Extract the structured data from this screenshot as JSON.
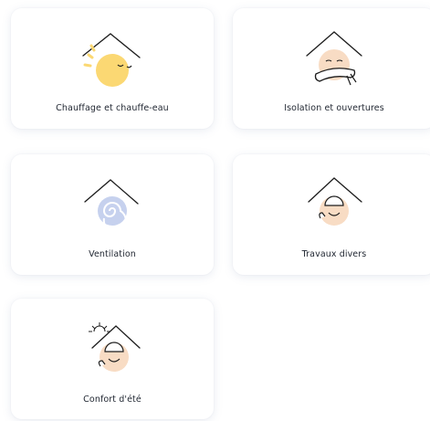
{
  "categories": [
    {
      "label": "Chauffage et chauffe-eau",
      "icon": "sun-house-icon"
    },
    {
      "label": "Isolation et ouvertures",
      "icon": "scarf-face-house-icon"
    },
    {
      "label": "Ventilation",
      "icon": "swirl-house-icon"
    },
    {
      "label": "Travaux divers",
      "icon": "worker-house-icon"
    },
    {
      "label": "Confort d'été",
      "icon": "summer-worker-house-icon"
    }
  ],
  "colors": {
    "peach": "#f8dcc4",
    "sun": "#fbd873",
    "swirl": "#c6d1ee",
    "line": "#1c1c1c"
  }
}
